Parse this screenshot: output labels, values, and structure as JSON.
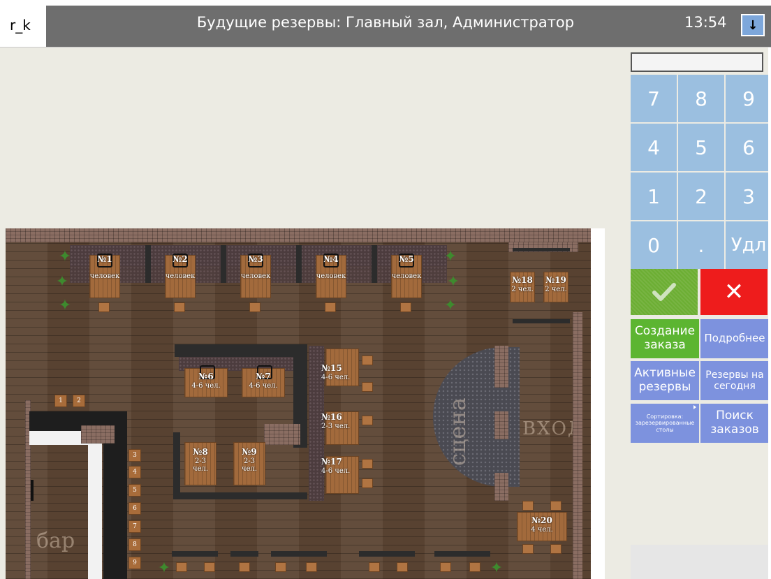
{
  "header": {
    "logo": "r_k",
    "title": "Будущие резервы: Главный зал, Администратор",
    "time": "13:54",
    "download_icon": "arrow-down-icon"
  },
  "numpad": {
    "display_value": "",
    "keys": [
      "7",
      "8",
      "9",
      "4",
      "5",
      "6",
      "1",
      "2",
      "3",
      "0",
      ".",
      "Удл"
    ]
  },
  "actions": {
    "confirm_icon": "checkmark-icon",
    "cancel_icon": "close-icon",
    "create_order": "Создание заказа",
    "details": "Подробнее",
    "active_reserves": "Активные резервы",
    "reserves_today": "Резервы на сегодня",
    "sort": "Сортировка: зарезервированные столы",
    "search_orders": "Поиск заказов"
  },
  "floor": {
    "tables_top": [
      {
        "num": "№1",
        "cap": "человек"
      },
      {
        "num": "№2",
        "cap": "человек"
      },
      {
        "num": "№3",
        "cap": "человек"
      },
      {
        "num": "№4",
        "cap": "человек"
      },
      {
        "num": "№5",
        "cap": "человек"
      }
    ],
    "t18": {
      "num": "№18",
      "cap": "2 чел."
    },
    "t19": {
      "num": "№19",
      "cap": "2 чел."
    },
    "t6": {
      "num": "№6",
      "cap": "4-6 чел."
    },
    "t7": {
      "num": "№7",
      "cap": "4-6 чел."
    },
    "t15": {
      "num": "№15",
      "cap": "4-6 чел."
    },
    "t16": {
      "num": "№16",
      "cap": "2-3 чел."
    },
    "t17": {
      "num": "№17",
      "cap": "4-6 чел."
    },
    "t8": {
      "num": "№8",
      "cap1": "2-3",
      "cap2": "чел."
    },
    "t9": {
      "num": "№9",
      "cap1": "2-3",
      "cap2": "чел."
    },
    "t20": {
      "num": "№20",
      "cap": "4 чел."
    },
    "bar_seats": [
      "1",
      "2",
      "3",
      "4",
      "5",
      "6",
      "7",
      "8",
      "9"
    ],
    "stage_label": "сцена",
    "entrance_label": "ВХОД",
    "bar_label": "бар"
  }
}
